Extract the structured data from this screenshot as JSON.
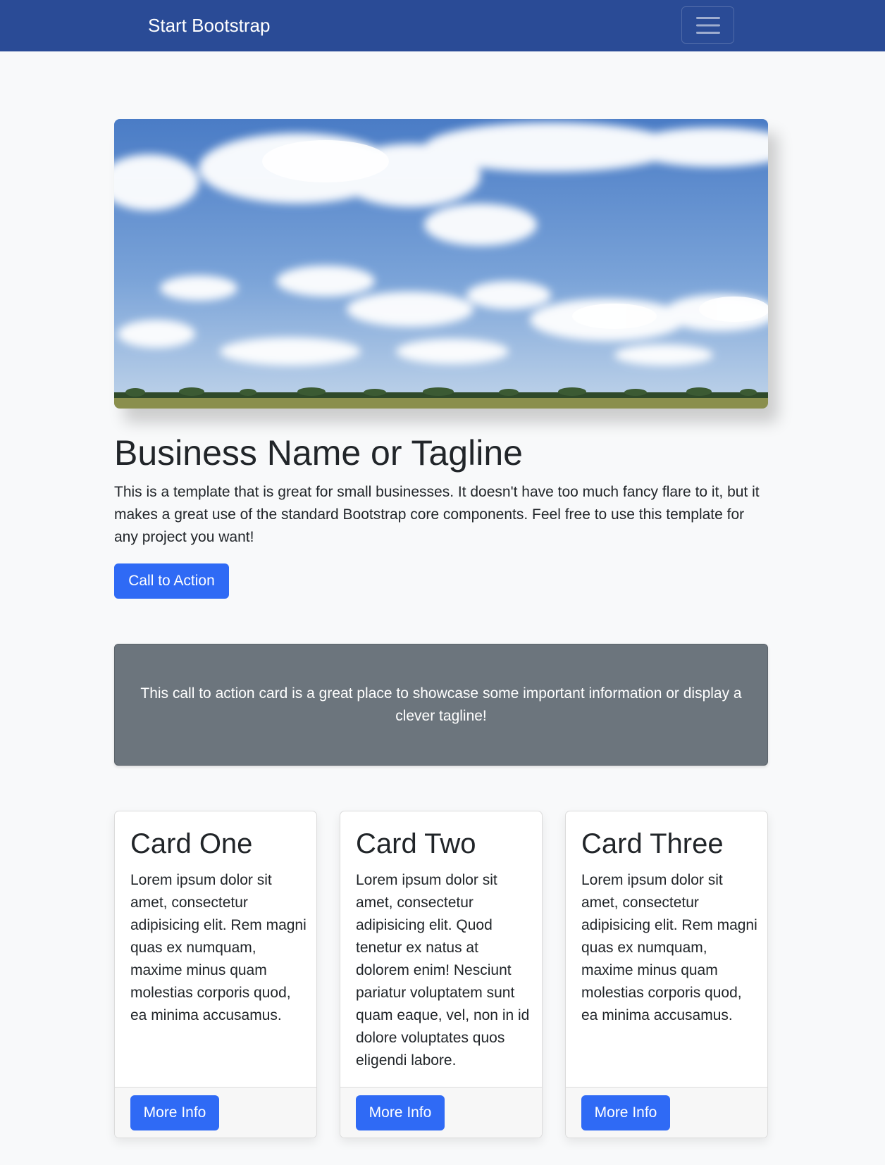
{
  "navbar": {
    "brand": "Start Bootstrap",
    "toggler_icon": "hamburger-menu-icon",
    "background": "#2a4b96"
  },
  "hero": {
    "image": "sky-clouds-landscape",
    "title": "Business Name or Tagline",
    "lead": "This is a template that is great for small businesses. It doesn't have too much fancy flare to it, but it makes a great use of the standard Bootstrap core components. Feel free to use this template for any project you want!",
    "cta_label": "Call to Action"
  },
  "cta_card": {
    "text": "This call to action card is a great place to showcase some important information or display a clever tagline!",
    "background": "#6c757d"
  },
  "cards": [
    {
      "title": "Card One",
      "text": "Lorem ipsum dolor sit amet, consectetur adipisicing elit. Rem magni quas ex numquam, maxime minus quam molestias corporis quod, ea minima accusamus.",
      "button": "More Info"
    },
    {
      "title": "Card Two",
      "text": "Lorem ipsum dolor sit amet, consectetur adipisicing elit. Quod tenetur ex natus at dolorem enim! Nesciunt pariatur voluptatem sunt quam eaque, vel, non in id dolore voluptates quos eligendi labore.",
      "button": "More Info"
    },
    {
      "title": "Card Three",
      "text": "Lorem ipsum dolor sit amet, consectetur adipisicing elit. Rem magni quas ex numquam, maxime minus quam molestias corporis quod, ea minima accusamus.",
      "button": "More Info"
    }
  ],
  "colors": {
    "primary_button": "#2f6af5",
    "page_background": "#f8f9fa"
  }
}
